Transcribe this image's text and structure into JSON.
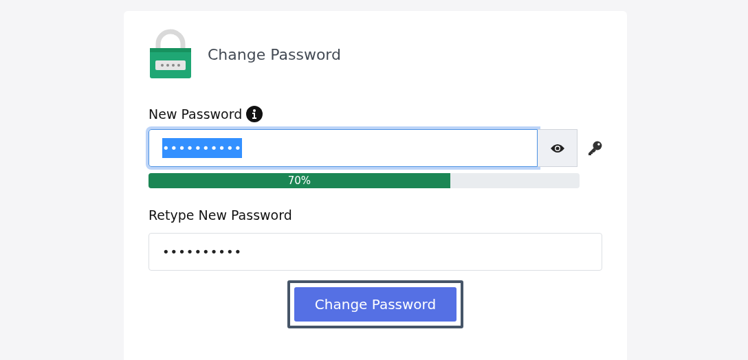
{
  "title": "Change Password",
  "new_password": {
    "label": "New Password",
    "value": "••••••••••",
    "focused": true,
    "text_selected": true,
    "strength": {
      "level": 0.7,
      "reading": "70%"
    }
  },
  "retype_password": {
    "label": "Retype New Password",
    "value": "••••••••••",
    "focused": false,
    "text_selected": false
  },
  "submit": {
    "label": "Change Password",
    "focused": true
  }
}
